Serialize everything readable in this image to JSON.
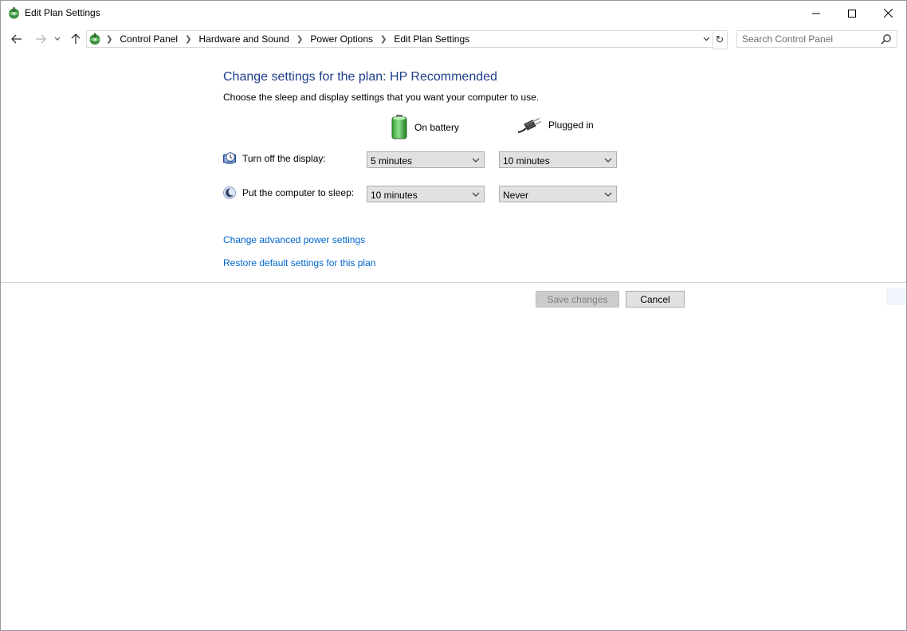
{
  "window": {
    "title": "Edit Plan Settings"
  },
  "address_bar": {
    "crumbs": [
      "Control Panel",
      "Hardware and Sound",
      "Power Options",
      "Edit Plan Settings"
    ]
  },
  "search": {
    "placeholder": "Search Control Panel"
  },
  "main": {
    "heading": "Change settings for the plan: HP Recommended",
    "subheading": "Choose the sleep and display settings that you want your computer to use.",
    "columns": {
      "battery": "On battery",
      "plugged": "Plugged in"
    },
    "rows": {
      "display": {
        "label": "Turn off the display:",
        "battery": "5 minutes",
        "plugged": "10 minutes"
      },
      "sleep": {
        "label": "Put the computer to sleep:",
        "battery": "10 minutes",
        "plugged": "Never"
      }
    },
    "links": {
      "advanced": "Change advanced power settings",
      "restore": "Restore default settings for this plan"
    }
  },
  "buttons": {
    "save": "Save changes",
    "cancel": "Cancel"
  },
  "colors": {
    "heading": "#1e3f8a",
    "link": "#0066cc",
    "disabled_text": "#838383"
  }
}
